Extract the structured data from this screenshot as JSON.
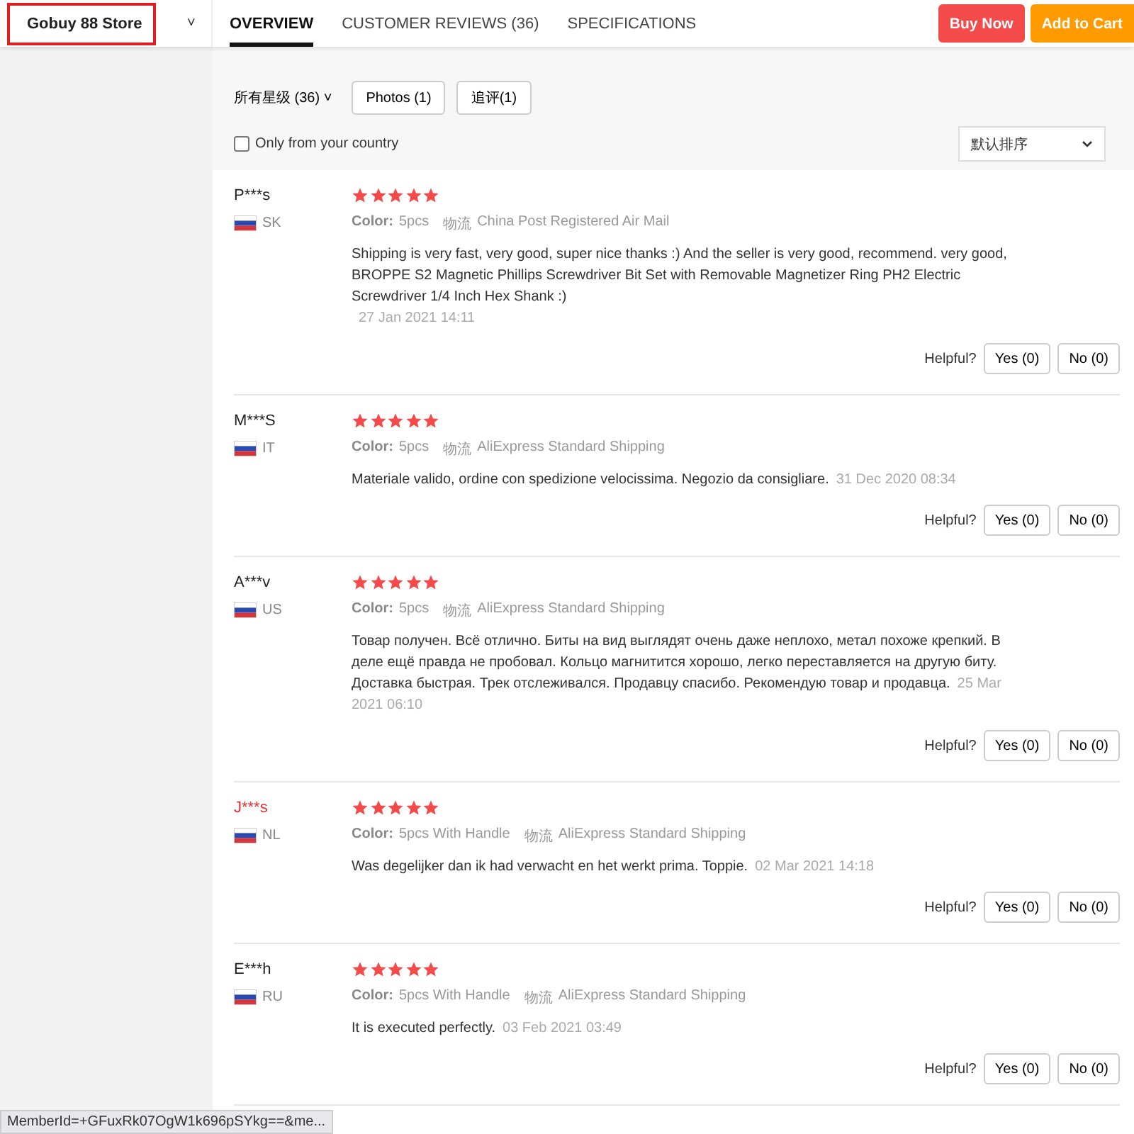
{
  "header": {
    "store_name": "Gobuy 88 Store",
    "store_caret": "˅",
    "tabs": [
      {
        "label": "OVERVIEW",
        "selected": true
      },
      {
        "label": "CUSTOMER REVIEWS (36)",
        "selected": false
      },
      {
        "label": "SPECIFICATIONS",
        "selected": false
      }
    ],
    "buy_now": "Buy Now",
    "add_to_cart": "Add to Cart"
  },
  "filters": {
    "rating_filter": "所有星级 (36)",
    "rating_caret": "˅",
    "photos": "Photos (1)",
    "followup": "追评(1)",
    "only_country": {
      "label": "Only from your country",
      "checked": false
    },
    "sort": "默认排序"
  },
  "reviews": [
    {
      "name": "P***s",
      "highlighted": false,
      "country": "SK",
      "stars": 5,
      "color_label": "Color:",
      "color_value": "5pcs",
      "shipping_label": "物流",
      "shipping": "China Post Registered Air Mail",
      "text": "Shipping is very fast, very good, super nice thanks :) And the seller is very good, recommend. very good, BROPPE S2 Magnetic Phillips Screwdriver Bit Set with Removable Magnetizer Ring PH2 Electric Screwdriver 1/4 Inch Hex Shank :)",
      "date": "27 Jan 2021 14:11",
      "date_on_own_line": true,
      "helpful_label": "Helpful?",
      "yes": "Yes (0)",
      "no": "No (0)"
    },
    {
      "name": "M***S",
      "highlighted": false,
      "country": "IT",
      "stars": 5,
      "color_label": "Color:",
      "color_value": "5pcs",
      "shipping_label": "物流",
      "shipping": "AliExpress Standard Shipping",
      "text": "Materiale valido, ordine con spedizione velocissima. Negozio da consigliare.",
      "date": "31 Dec 2020 08:34",
      "date_on_own_line": false,
      "helpful_label": "Helpful?",
      "yes": "Yes (0)",
      "no": "No (0)"
    },
    {
      "name": "A***v",
      "highlighted": false,
      "country": "US",
      "stars": 5,
      "color_label": "Color:",
      "color_value": "5pcs",
      "shipping_label": "物流",
      "shipping": "AliExpress Standard Shipping",
      "text": "Товар получен. Всё отлично. Биты на вид выглядят очень даже неплохо, метал похоже крепкий. В деле ещё правда не пробовал. Кольцо магнитится хорошо, легко переставляется на другую биту. Доставка быстрая. Трек отслеживался. Продавцу спасибо. Рекомендую товар и продавца.",
      "date": "25 Mar 2021 06:10",
      "date_on_own_line": false,
      "helpful_label": "Helpful?",
      "yes": "Yes (0)",
      "no": "No (0)"
    },
    {
      "name": "J***s",
      "highlighted": true,
      "country": "NL",
      "stars": 5,
      "color_label": "Color:",
      "color_value": "5pcs With Handle",
      "shipping_label": "物流",
      "shipping": "AliExpress Standard Shipping",
      "text": "Was degelijker dan ik had verwacht en het werkt prima. Toppie.",
      "date": "02 Mar 2021 14:18",
      "date_on_own_line": false,
      "helpful_label": "Helpful?",
      "yes": "Yes (0)",
      "no": "No (0)"
    },
    {
      "name": "E***h",
      "highlighted": false,
      "country": "RU",
      "stars": 5,
      "color_label": "Color:",
      "color_value": "5pcs With Handle",
      "shipping_label": "物流",
      "shipping": "AliExpress Standard Shipping",
      "text": "It is executed perfectly.",
      "date": "03 Feb 2021 03:49",
      "date_on_own_line": false,
      "helpful_label": "Helpful?",
      "yes": "Yes (0)",
      "no": "No (0)"
    }
  ],
  "status_bar": {
    "url": "MemberId=+GFuxRk07OgW1k696pSYkg==&me..."
  }
}
